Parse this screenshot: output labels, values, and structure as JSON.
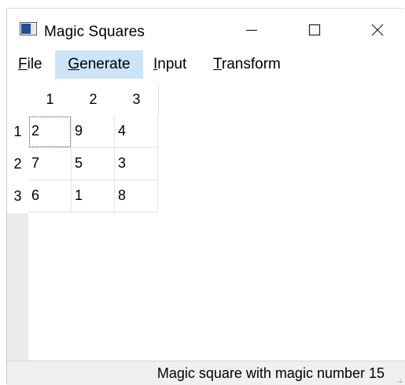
{
  "window": {
    "title": "Magic Squares",
    "controls": [
      "minimize-icon",
      "maximize-icon",
      "close-icon"
    ]
  },
  "menu": {
    "items": [
      {
        "label": "File",
        "mnemonic": "F"
      },
      {
        "label": "Generate",
        "mnemonic": "G"
      },
      {
        "label": "Input",
        "mnemonic": "I"
      },
      {
        "label": "Transform",
        "mnemonic": "T"
      }
    ],
    "active": "Generate",
    "active_color": "#cce4f7"
  },
  "grid": {
    "columns": [
      "1",
      "2",
      "3"
    ],
    "rows": [
      {
        "header": "1",
        "cells": [
          "2",
          "9",
          "4"
        ]
      },
      {
        "header": "2",
        "cells": [
          "7",
          "5",
          "3"
        ]
      },
      {
        "header": "3",
        "cells": [
          "6",
          "1",
          "8"
        ]
      }
    ]
  },
  "status": {
    "text": "Magic square with magic number 15"
  }
}
